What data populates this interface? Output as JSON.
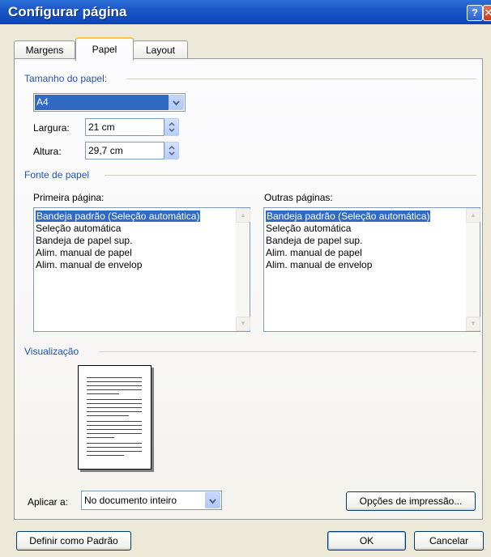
{
  "window": {
    "title": "Configurar página",
    "help_glyph": "?",
    "close_glyph": "✕"
  },
  "tabs": [
    {
      "label": "Margens",
      "active": false
    },
    {
      "label": "Papel",
      "active": true
    },
    {
      "label": "Layout",
      "active": false
    }
  ],
  "paper_size": {
    "section_label": "Tamanho do papel:",
    "selected": "A4",
    "width_label": "Largura:",
    "width_value": "21 cm",
    "height_label": "Altura:",
    "height_value": "29,7 cm"
  },
  "paper_source": {
    "section_label": "Fonte de papel",
    "first_page_label": "Primeira página:",
    "other_pages_label": "Outras páginas:",
    "first_page_items": [
      "Bandeja padrão (Seleção automática)",
      "Seleção automática",
      "Bandeja de papel sup.",
      "Alim. manual de papel",
      "Alim. manual de envelop"
    ],
    "other_pages_items": [
      "Bandeja padrão (Seleção automática)",
      "Seleção automática",
      "Bandeja de papel sup.",
      "Alim. manual de papel",
      "Alim. manual de envelop"
    ],
    "selected_index": 0
  },
  "preview": {
    "section_label": "Visualização"
  },
  "apply": {
    "label": "Aplicar a:",
    "value": "No documento inteiro"
  },
  "buttons": {
    "print_options": "Opções de impressão...",
    "set_default": "Definir como Padrão",
    "ok": "OK",
    "cancel": "Cancelar"
  },
  "colors": {
    "title_bar": "#0a45b8",
    "section_label": "#2352b6",
    "selection": "#316ac5",
    "dialog_bg": "#ece9d8"
  }
}
